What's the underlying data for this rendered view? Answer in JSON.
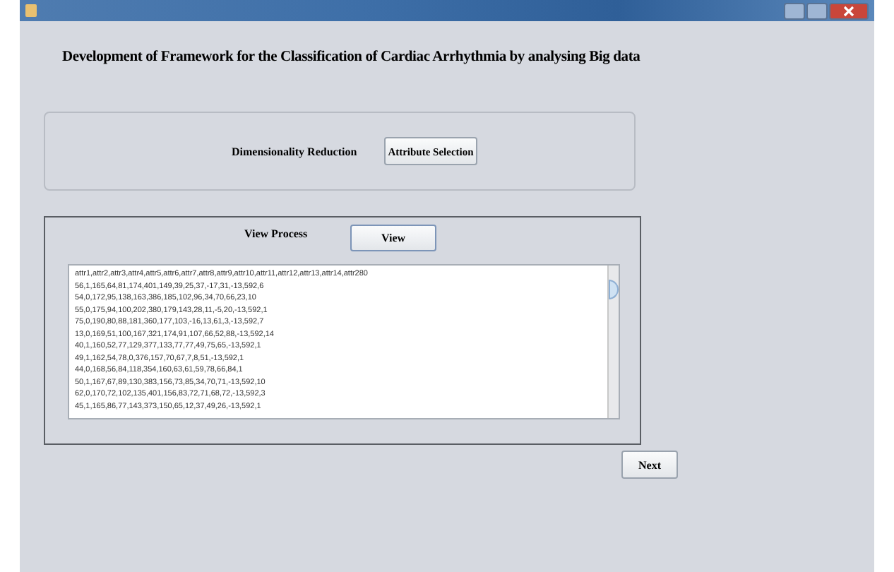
{
  "heading": "Development of Framework for the Classification of Cardiac Arrhythmia by analysing Big data",
  "reduction_panel": {
    "label": "Dimensionality Reduction",
    "button": "Attribute Selection"
  },
  "process_panel": {
    "label": "View Process",
    "button": "View",
    "output_lines": [
      "attr1,attr2,attr3,attr4,attr5,attr6,attr7,attr8,attr9,attr10,attr11,attr12,attr13,attr14,attr280",
      "56,1,165,64,81,174,401,149,39,25,37,-17,31,-13,592,6",
      "54,0,172,95,138,163,386,185,102,96,34,70,66,23,10",
      "55,0,175,94,100,202,380,179,143,28,11,-5,20,-13,592,1",
      "75,0,190,80,88,181,360,177,103,-16,13,61,3,-13,592,7",
      "13,0,169,51,100,167,321,174,91,107,66,52,88,-13,592,14",
      "40,1,160,52,77,129,377,133,77,77,49,75,65,-13,592,1",
      "49,1,162,54,78,0,376,157,70,67,7,8,51,-13,592,1",
      "44,0,168,56,84,118,354,160,63,61,59,78,66,84,1",
      "50,1,167,67,89,130,383,156,73,85,34,70,71,-13,592,10",
      "62,0,170,72,102,135,401,156,83,72,71,68,72,-13,592,3",
      "45,1,165,86,77,143,373,150,65,12,37,49,26,-13,592,1"
    ]
  },
  "footer_button": "Next"
}
